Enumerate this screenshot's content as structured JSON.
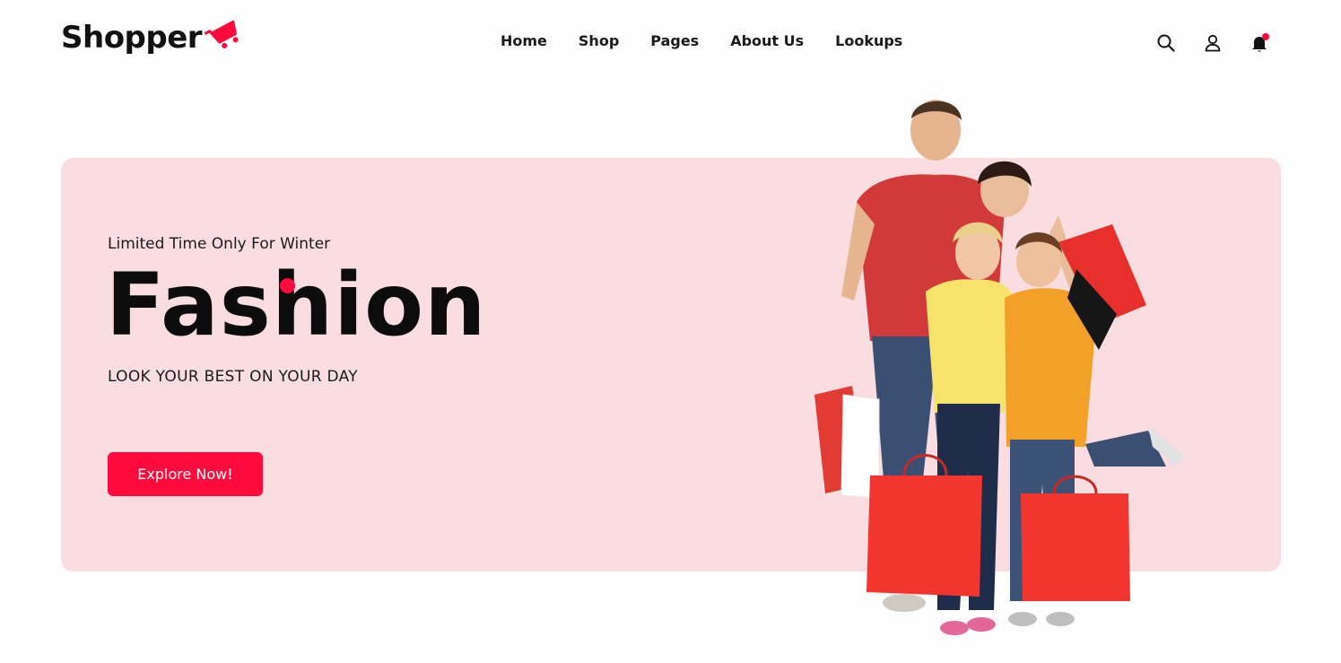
{
  "header": {
    "logo_text": "Shopper",
    "nav": [
      {
        "label": "Home"
      },
      {
        "label": "Shop"
      },
      {
        "label": "Pages"
      },
      {
        "label": "About Us"
      },
      {
        "label": "Lookups"
      }
    ],
    "icons": [
      "search-icon",
      "user-icon",
      "bell-icon"
    ]
  },
  "hero": {
    "kicker": "Limited Time Only For Winter",
    "title": "Fashion",
    "tagline": "LOOK YOUR BEST ON YOUR DAY",
    "button_label": "Explore Now!"
  },
  "colors": {
    "accent": "#ff0a3c",
    "hero_bg": "#f9dde0",
    "text": "#111111"
  }
}
